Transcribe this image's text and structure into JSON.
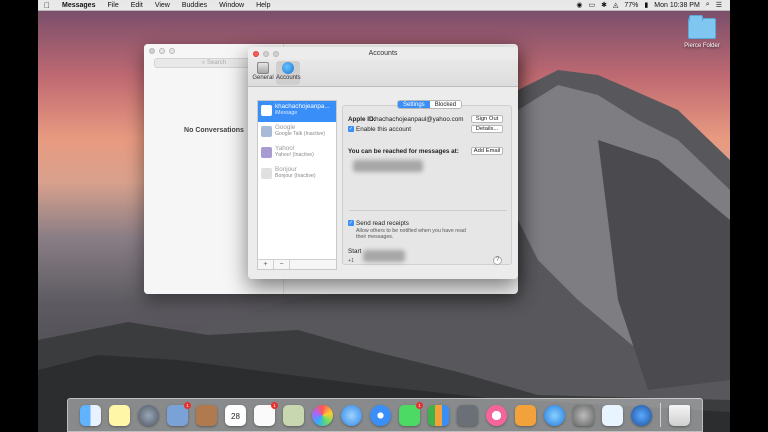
{
  "menubar": {
    "app": "Messages",
    "items": [
      "File",
      "Edit",
      "View",
      "Buddies",
      "Window",
      "Help"
    ],
    "battery": "77%",
    "clock": "Mon 10:38 PM"
  },
  "desktop": {
    "folder_label": "Pierce Folder"
  },
  "messages_window": {
    "search_placeholder": "Search",
    "empty_label": "No Conversations"
  },
  "accounts_window": {
    "title": "Accounts",
    "toolbar": [
      {
        "label": "General",
        "icon": "general-icon"
      },
      {
        "label": "Accounts",
        "icon": "at-icon"
      }
    ],
    "accounts": [
      {
        "name": "khachachojeanpa...",
        "type": "iMessage"
      },
      {
        "name": "Google",
        "type": "Google Talk (Inactive)"
      },
      {
        "name": "Yahoo!",
        "type": "Yahoo! (Inactive)"
      },
      {
        "name": "Bonjour",
        "type": "Bonjour (Inactive)"
      }
    ],
    "list_footer": {
      "add": "+",
      "remove": "−"
    },
    "tabs": {
      "settings": "Settings",
      "blocked": "Blocked"
    },
    "apple_id_label": "Apple ID:",
    "apple_id_value": "khachachojeanpaul@yahoo.com",
    "sign_out_label": "Sign Out",
    "details_label": "Details...",
    "enable_label": "Enable this account",
    "reach_label": "You can be reached for messages at:",
    "add_email_label": "Add Email",
    "read_receipts_label": "Send read receipts",
    "read_receipts_desc_1": "Allow others to be notified when you have read",
    "read_receipts_desc_2": "their messages.",
    "start_label": "Start",
    "start_value": "+1",
    "help_label": "?"
  },
  "dock": {
    "icons": [
      "finder-icon",
      "notes-icon",
      "launchpad-icon",
      "mail-stamp-icon",
      "contacts-icon",
      "calendar-icon",
      "reminders-icon",
      "preview-icon",
      "photos-icon",
      "messages-icon",
      "safari-icon",
      "facetime-icon",
      "numbers-icon",
      "keynote-icon",
      "itunes-icon",
      "ibooks-icon",
      "app-store-icon",
      "system-preferences-icon",
      "teamviewer-icon",
      "quicktime-icon",
      "trash-icon"
    ],
    "calendar_day": "28",
    "badges": {
      "mail": "1",
      "reminders": "1",
      "facetime": "1"
    }
  }
}
